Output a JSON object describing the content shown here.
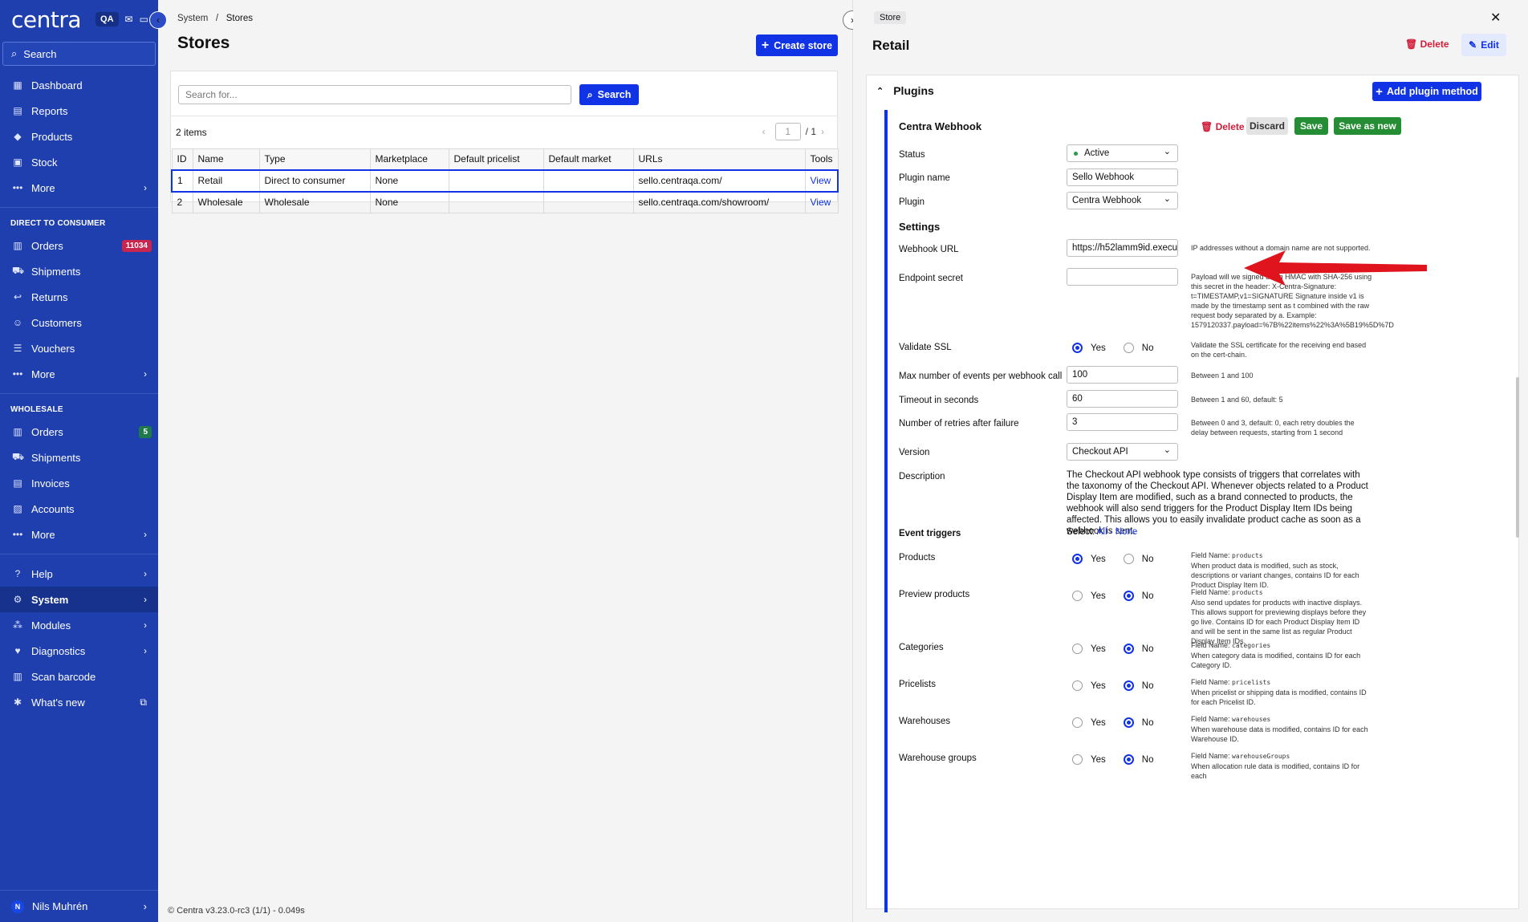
{
  "sidebar": {
    "logo": "centra",
    "env_badge": "QA",
    "search_placeholder": "Search",
    "main_items": [
      {
        "label": "Dashboard",
        "icon": "dashboard-icon"
      },
      {
        "label": "Reports",
        "icon": "reports-icon"
      },
      {
        "label": "Products",
        "icon": "tag-icon"
      },
      {
        "label": "Stock",
        "icon": "box-icon"
      },
      {
        "label": "More",
        "icon": "dots-icon"
      }
    ],
    "dtc_section": "DIRECT TO CONSUMER",
    "dtc_items": [
      {
        "label": "Orders",
        "icon": "orders-icon",
        "count": "11034"
      },
      {
        "label": "Shipments",
        "icon": "truck-icon"
      },
      {
        "label": "Returns",
        "icon": "return-icon"
      },
      {
        "label": "Customers",
        "icon": "smile-icon"
      },
      {
        "label": "Vouchers",
        "icon": "voucher-icon"
      },
      {
        "label": "More",
        "icon": "dots-icon"
      }
    ],
    "wholesale_section": "WHOLESALE",
    "wholesale_items": [
      {
        "label": "Orders",
        "icon": "orders-icon",
        "count": "5"
      },
      {
        "label": "Shipments",
        "icon": "truck-icon"
      },
      {
        "label": "Invoices",
        "icon": "invoice-icon"
      },
      {
        "label": "Accounts",
        "icon": "accounts-icon"
      },
      {
        "label": "More",
        "icon": "dots-icon"
      }
    ],
    "bottom_items": [
      {
        "label": "Help",
        "icon": "help-icon"
      },
      {
        "label": "System",
        "icon": "gear-icon"
      },
      {
        "label": "Modules",
        "icon": "modules-icon"
      },
      {
        "label": "Diagnostics",
        "icon": "heart-icon"
      },
      {
        "label": "Scan barcode",
        "icon": "barcode-icon"
      },
      {
        "label": "What's new",
        "icon": "external-link-icon"
      }
    ],
    "user": {
      "initial": "N",
      "name": "Nils Muhrén"
    }
  },
  "main": {
    "breadcrumb": [
      "System",
      "Stores"
    ],
    "title": "Stores",
    "create_label": "Create store",
    "search_placeholder": "Search for...",
    "search_button": "Search",
    "items_count": "2 items",
    "page_current": "1",
    "page_total": "/ 1",
    "columns": [
      "ID",
      "Name",
      "Type",
      "Marketplace",
      "Default pricelist",
      "Default market",
      "URLs",
      "Tools"
    ],
    "rows": [
      {
        "id": "1",
        "name": "Retail",
        "type": "Direct to consumer",
        "marketplace": "None",
        "pricelist": "",
        "market": "",
        "url": "sello.centraqa.com/",
        "tool": "View"
      },
      {
        "id": "2",
        "name": "Wholesale",
        "type": "Wholesale",
        "marketplace": "None",
        "pricelist": "",
        "market": "",
        "url": "sello.centraqa.com/showroom/",
        "tool": "View"
      }
    ],
    "footer": "© Centra v3.23.0-rc3 (1/1) - 0.049s"
  },
  "detail": {
    "tag": "Store",
    "title": "Retail",
    "delete_label": "Delete",
    "edit_label": "Edit",
    "plugins_heading": "Plugins",
    "add_plugin_label": "Add plugin method",
    "plugin": {
      "title": "Centra Webhook",
      "delete_label": "Delete",
      "discard_label": "Discard",
      "save_label": "Save",
      "save_as_new_label": "Save as new",
      "status_label": "Status",
      "status_value": "Active",
      "name_label": "Plugin name",
      "name_value": "Sello Webhook",
      "plugin_label": "Plugin",
      "plugin_value": "Centra Webhook",
      "settings_heading": "Settings",
      "webhook_url_label": "Webhook URL",
      "webhook_url_value": "https://h52lamm9id.execute-",
      "webhook_url_help": "IP addresses without a domain name are not supported.",
      "secret_label": "Endpoint secret",
      "secret_help": "Payload will we signed using HMAC with SHA-256 using this secret in the header: X-Centra-Signature: t=TIMESTAMP,v1=SIGNATURE Signature inside v1 is made by the timestamp sent as t combined with the raw request body separated by a. Example: 1579120337.payload=%7B%22items%22%3A%5B19%5D%7D",
      "ssl_label": "Validate SSL",
      "ssl_help": "Validate the SSL certificate for the receiving end based on the cert-chain.",
      "max_events_label": "Max number of events per webhook call",
      "max_events_value": "100",
      "max_events_help": "Between 1 and 100",
      "timeout_label": "Timeout in seconds",
      "timeout_value": "60",
      "timeout_help": "Between 1 and 60, default: 5",
      "retries_label": "Number of retries after failure",
      "retries_value": "3",
      "retries_help": "Between 0 and 3, default: 0, each retry doubles the delay between requests, starting from 1 second",
      "version_label": "Version",
      "version_value": "Checkout API",
      "description_label": "Description",
      "description_text": "The Checkout API webhook type consists of triggers that correlates with the taxonomy of the Checkout API. Whenever objects related to a Product Display Item are modified, such as a brand connected to products, the webhook will also send triggers for the Product Display Item IDs being affected. This allows you to easily invalidate product cache as soon as a webhook is sent.",
      "triggers_heading": "Event triggers",
      "select_label": "Select:",
      "select_all": "All",
      "select_sep": "-",
      "select_none": "None",
      "yes": "Yes",
      "no": "No",
      "field_name_prefix": "Field Name:",
      "triggers": [
        {
          "label": "Products",
          "field": "products",
          "help": "When product data is modified, such as stock, descriptions or variant changes, contains ID for each Product Display Item ID.",
          "value": "yes"
        },
        {
          "label": "Preview products",
          "field": "products",
          "help": "Also send updates for products with inactive displays. This allows support for previewing displays before they go live. Contains ID for each Product Display Item ID and will be sent in the same list as regular Product Display Item IDs.",
          "value": "no"
        },
        {
          "label": "Categories",
          "field": "categories",
          "help": "When category data is modified, contains ID for each Category ID.",
          "value": "no"
        },
        {
          "label": "Pricelists",
          "field": "pricelists",
          "help": "When pricelist or shipping data is modified, contains ID for each Pricelist ID.",
          "value": "no"
        },
        {
          "label": "Warehouses",
          "field": "warehouses",
          "help": "When warehouse data is modified, contains ID for each Warehouse ID.",
          "value": "no"
        },
        {
          "label": "Warehouse groups",
          "field": "warehouseGroups",
          "help": "When allocation rule data is modified, contains ID for each",
          "value": "no"
        }
      ]
    }
  },
  "colors": {
    "sidebar": "#1f3fae",
    "primary": "#1133e6",
    "danger": "#d11d3a",
    "success": "#258d33",
    "annotation_arrow": "#e0141c"
  }
}
